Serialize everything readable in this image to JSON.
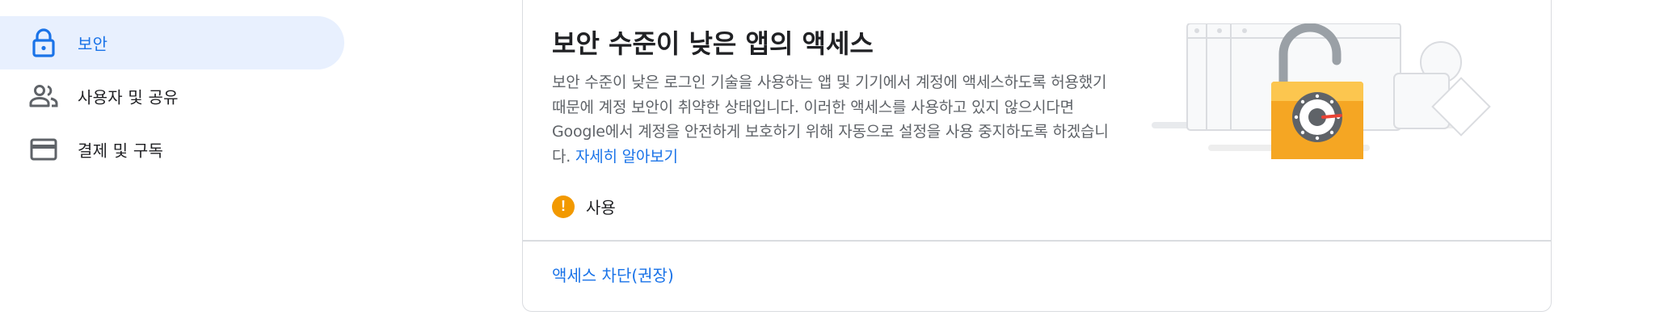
{
  "sidebar": {
    "items": [
      {
        "label": "보안",
        "icon": "lock-icon",
        "active": true
      },
      {
        "label": "사용자 및 공유",
        "icon": "people-icon",
        "active": false
      },
      {
        "label": "결제 및 구독",
        "icon": "credit-card-icon",
        "active": false
      }
    ]
  },
  "card": {
    "title": "보안 수준이 낮은 앱의 액세스",
    "description": "보안 수준이 낮은 로그인 기술을 사용하는 앱 및 기기에서 계정에 액세스하도록 허용했기 때문에 계정 보안이 취약한 상태입니다. 이러한 액세스를 사용하고 있지 않으시다면 Google에서 계정을 안전하게 보호하기 위해 자동으로 설정을 사용 중지하도록 하겠습니다.",
    "learn_more": "자세히 알아보기",
    "status": {
      "text": "사용",
      "icon": "warning-icon"
    },
    "action": "액세스 차단(권장)"
  },
  "colors": {
    "accent": "#1a73e8",
    "active_bg": "#e8f0fe",
    "warning": "#f29900",
    "lock_body": "#f5a623"
  }
}
